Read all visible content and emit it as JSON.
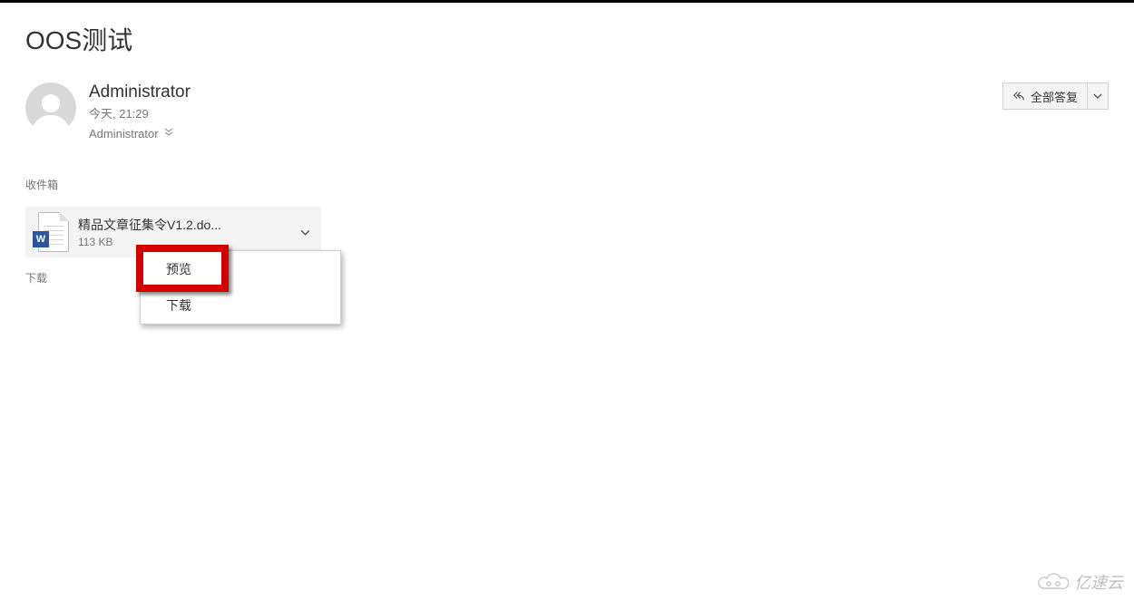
{
  "subject": "OOS测试",
  "sender": {
    "name": "Administrator",
    "timestamp": "今天, 21:29"
  },
  "recipient": {
    "name": "Administrator"
  },
  "reply": {
    "all_label": "全部答复"
  },
  "folder_label": "收件箱",
  "attachment": {
    "file_name": "精品文章征集令V1.2.do...",
    "file_size": "113 KB",
    "badge": "W"
  },
  "download_label": "下载",
  "dropdown": {
    "preview": "预览",
    "download": "下载"
  },
  "watermark": "亿速云"
}
